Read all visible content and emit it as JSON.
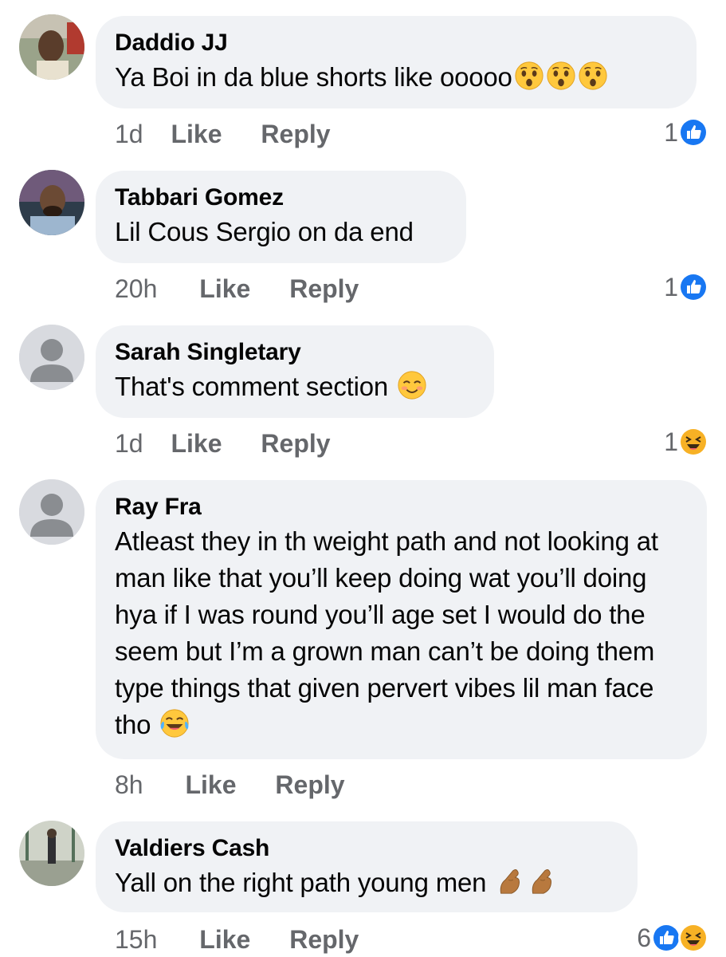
{
  "colors": {
    "bubble": "#f0f2f5",
    "meta_text": "#65676b",
    "like_blue": "#1877f2",
    "haha_yellow": "#f7b125"
  },
  "actions": {
    "like": "Like",
    "reply": "Reply"
  },
  "comments": [
    {
      "author": "Daddio JJ",
      "text": "Ya Boi in da blue shorts like ooooo",
      "emojis": [
        "astonished-face-icon",
        "astonished-face-icon",
        "astonished-face-icon"
      ],
      "time": "1d",
      "reaction_count": "1",
      "reactions": [
        "like-reaction-icon"
      ]
    },
    {
      "author": "Tabbari Gomez",
      "text": "Lil Cous Sergio on da end",
      "emojis": [],
      "time": "20h",
      "reaction_count": "1",
      "reactions": [
        "like-reaction-icon"
      ]
    },
    {
      "author": "Sarah Singletary",
      "text": "That's comment section",
      "emojis": [
        "smiling-blush-face-icon"
      ],
      "time": "1d",
      "reaction_count": "1",
      "reactions": [
        "haha-reaction-icon"
      ]
    },
    {
      "author": "Ray Fra",
      "text": "Atleast they in th weight path and not looking at man like that you’ll keep doing wat you’ll doing hya if I was round you’ll age set I would do the seem but I’m a grown man can’t be doing them type things that given pervert vibes lil man face tho",
      "emojis": [
        "tears-of-joy-face-icon"
      ],
      "time": "8h",
      "reaction_count": "",
      "reactions": []
    },
    {
      "author": "Valdiers Cash",
      "text": "Yall on the right path young men",
      "emojis": [
        "pinched-fingers-icon",
        "pinched-fingers-icon"
      ],
      "time": "15h",
      "reaction_count": "6",
      "reactions": [
        "like-reaction-icon",
        "haha-reaction-icon"
      ]
    }
  ]
}
